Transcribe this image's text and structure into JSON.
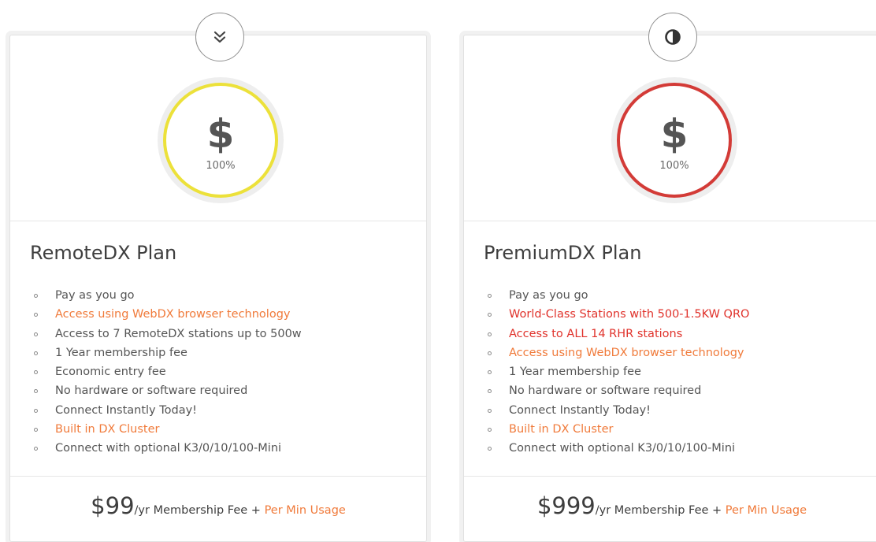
{
  "colors": {
    "text": "#555555",
    "orange": "#f07a3a",
    "red": "#e0322b",
    "remote_ring": "#ece13a",
    "premium_ring": "#d33b37"
  },
  "plans": [
    {
      "badge_icon": "double-chevron-down-icon",
      "gauge_symbol": "$",
      "gauge_percent": "100%",
      "title": "RemoteDX Plan",
      "features": [
        {
          "text": "Pay as you go",
          "color": "#555555"
        },
        {
          "text": "Access using WebDX browser technology",
          "color": "#f07a3a"
        },
        {
          "text": "Access to 7 RemoteDX stations up to 500w",
          "color": "#555555"
        },
        {
          "text": "1 Year membership fee",
          "color": "#555555"
        },
        {
          "text": "Economic entry fee",
          "color": "#555555"
        },
        {
          "text": "No hardware or software required",
          "color": "#555555"
        },
        {
          "text": "Connect Instantly Today!",
          "color": "#555555"
        },
        {
          "text": "Built in DX Cluster",
          "color": "#f07a3a"
        },
        {
          "text": "Connect with optional K3/0/10/100-Mini",
          "color": "#555555"
        }
      ],
      "price_amount": "$99",
      "price_suffix": "/yr",
      "price_fee": " Membership Fee + ",
      "price_link": "Per Min Usage"
    },
    {
      "badge_icon": "half-circle-contrast-icon",
      "gauge_symbol": "$",
      "gauge_percent": "100%",
      "title": "PremiumDX Plan",
      "features": [
        {
          "text": "Pay as you go",
          "color": "#555555"
        },
        {
          "text": "World-Class Stations with 500-1.5KW QRO",
          "color": "#e0322b"
        },
        {
          "text": "Access to ALL 14 RHR stations",
          "color": "#e0322b"
        },
        {
          "text": "Access using WebDX browser technology",
          "color": "#f07a3a"
        },
        {
          "text": "1 Year membership fee",
          "color": "#555555"
        },
        {
          "text": "No hardware or software required",
          "color": "#555555"
        },
        {
          "text": "Connect Instantly Today!",
          "color": "#555555"
        },
        {
          "text": "Built in DX Cluster",
          "color": "#f07a3a"
        },
        {
          "text": "Connect with optional K3/0/10/100-Mini",
          "color": "#555555"
        }
      ],
      "price_amount": "$999",
      "price_suffix": "/yr",
      "price_fee": " Membership Fee + ",
      "price_link": "Per Min Usage"
    }
  ]
}
